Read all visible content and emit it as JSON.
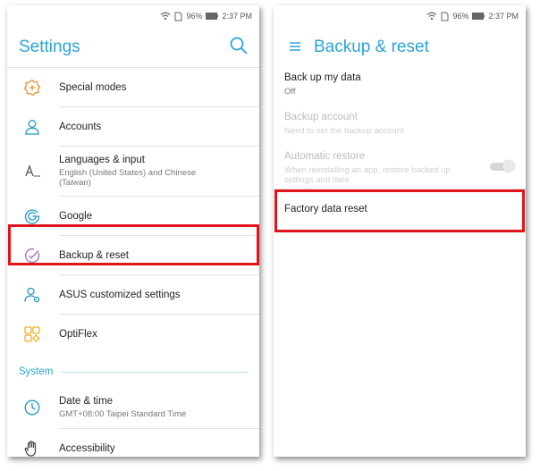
{
  "status": {
    "battery": "96%",
    "time": "2:37 PM"
  },
  "settings": {
    "title": "Settings",
    "items": [
      {
        "label": "Special modes",
        "sub": ""
      },
      {
        "label": "Accounts",
        "sub": ""
      },
      {
        "label": "Languages & input",
        "sub": "English (United States) and Chinese (Taiwan)"
      },
      {
        "label": "Google",
        "sub": ""
      },
      {
        "label": "Backup & reset",
        "sub": ""
      },
      {
        "label": "ASUS customized settings",
        "sub": ""
      },
      {
        "label": "OptiFlex",
        "sub": ""
      }
    ],
    "section_system": "System",
    "system_items": [
      {
        "label": "Date & time",
        "sub": "GMT+08:00 Taipei Standard Time"
      },
      {
        "label": "Accessibility",
        "sub": ""
      }
    ]
  },
  "backup": {
    "title": "Backup & reset",
    "items": [
      {
        "label": "Back up my data",
        "sub": "Off"
      },
      {
        "label": "Backup account",
        "sub": "Need to set the backup account"
      },
      {
        "label": "Automatic restore",
        "sub": "When reinstalling an app, restore backed up settings and data"
      },
      {
        "label": "Factory data reset",
        "sub": ""
      }
    ]
  },
  "colors": {
    "accent": "#2ba4d6",
    "highlight": "#e0141a",
    "icon_orange": "#f08a24",
    "icon_teal": "#1f9bbf",
    "icon_purple": "#9a6fc0"
  }
}
